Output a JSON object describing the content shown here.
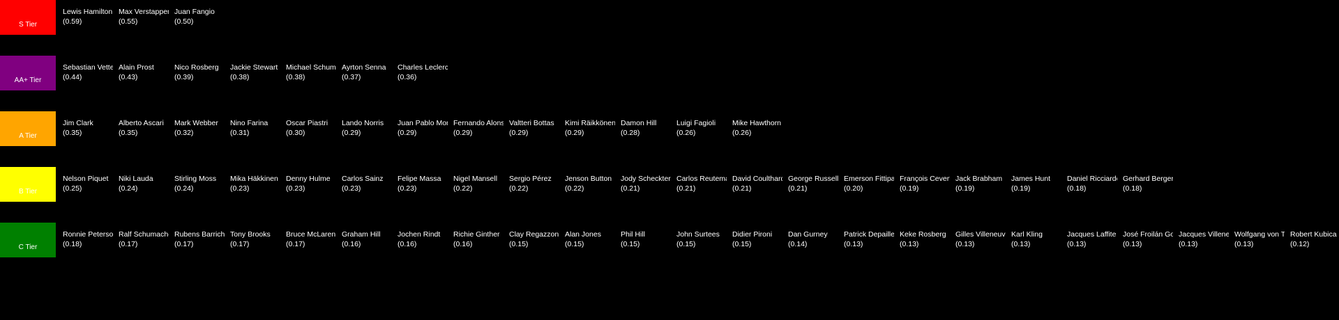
{
  "tiers": [
    {
      "key": "s",
      "label": "S Tier",
      "color": "#ff0000",
      "items": [
        {
          "name": "Lewis Hamilton",
          "score": "(0.59)"
        },
        {
          "name": "Max Verstappen",
          "score": "(0.55)"
        },
        {
          "name": "Juan Fangio",
          "score": "(0.50)"
        }
      ]
    },
    {
      "key": "aa-plus",
      "label": "AA+ Tier",
      "color": "#800080",
      "items": [
        {
          "name": "Sebastian Vettel",
          "score": "(0.44)"
        },
        {
          "name": "Alain Prost",
          "score": "(0.43)"
        },
        {
          "name": "Nico Rosberg",
          "score": "(0.39)"
        },
        {
          "name": "Jackie Stewart",
          "score": "(0.38)"
        },
        {
          "name": "Michael Schumacher",
          "score": "(0.38)"
        },
        {
          "name": "Ayrton Senna",
          "score": "(0.37)"
        },
        {
          "name": "Charles Leclerc",
          "score": "(0.36)"
        }
      ]
    },
    {
      "key": "a",
      "label": "A Tier",
      "color": "#ffa500",
      "items": [
        {
          "name": "Jim Clark",
          "score": "(0.35)"
        },
        {
          "name": "Alberto Ascari",
          "score": "(0.35)"
        },
        {
          "name": "Mark Webber",
          "score": "(0.32)"
        },
        {
          "name": "Nino Farina",
          "score": "(0.31)"
        },
        {
          "name": "Oscar Piastri",
          "score": "(0.30)"
        },
        {
          "name": "Lando Norris",
          "score": "(0.29)"
        },
        {
          "name": "Juan Pablo Montoya",
          "score": "(0.29)"
        },
        {
          "name": "Fernando Alonso",
          "score": "(0.29)"
        },
        {
          "name": "Valtteri Bottas",
          "score": "(0.29)"
        },
        {
          "name": "Kimi Räikkönen",
          "score": "(0.29)"
        },
        {
          "name": "Damon Hill",
          "score": "(0.28)"
        },
        {
          "name": "Luigi Fagioli",
          "score": "(0.26)"
        },
        {
          "name": "Mike Hawthorn",
          "score": "(0.26)"
        }
      ]
    },
    {
      "key": "b",
      "label": "B Tier",
      "color": "#ffff00",
      "items": [
        {
          "name": "Nelson Piquet",
          "score": "(0.25)"
        },
        {
          "name": "Niki Lauda",
          "score": "(0.24)"
        },
        {
          "name": "Stirling Moss",
          "score": "(0.24)"
        },
        {
          "name": "Mika Häkkinen",
          "score": "(0.23)"
        },
        {
          "name": "Denny Hulme",
          "score": "(0.23)"
        },
        {
          "name": "Carlos Sainz",
          "score": "(0.23)"
        },
        {
          "name": "Felipe Massa",
          "score": "(0.23)"
        },
        {
          "name": "Nigel Mansell",
          "score": "(0.22)"
        },
        {
          "name": "Sergio Pérez",
          "score": "(0.22)"
        },
        {
          "name": "Jenson Button",
          "score": "(0.22)"
        },
        {
          "name": "Jody Scheckter",
          "score": "(0.21)"
        },
        {
          "name": "Carlos Reutemann",
          "score": "(0.21)"
        },
        {
          "name": "David Coulthard",
          "score": "(0.21)"
        },
        {
          "name": "George Russell",
          "score": "(0.21)"
        },
        {
          "name": "Emerson Fittipaldi",
          "score": "(0.20)"
        },
        {
          "name": "François Cevert",
          "score": "(0.19)"
        },
        {
          "name": "Jack Brabham",
          "score": "(0.19)"
        },
        {
          "name": "James Hunt",
          "score": "(0.19)"
        },
        {
          "name": "Daniel Ricciardo",
          "score": "(0.18)"
        },
        {
          "name": "Gerhard Berger",
          "score": "(0.18)"
        }
      ]
    },
    {
      "key": "c",
      "label": "C Tier",
      "color": "#008000",
      "items": [
        {
          "name": "Ronnie Peterson",
          "score": "(0.18)"
        },
        {
          "name": "Ralf Schumacher",
          "score": "(0.17)"
        },
        {
          "name": "Rubens Barrichello",
          "score": "(0.17)"
        },
        {
          "name": "Tony Brooks",
          "score": "(0.17)"
        },
        {
          "name": "Bruce McLaren",
          "score": "(0.17)"
        },
        {
          "name": "Graham Hill",
          "score": "(0.16)"
        },
        {
          "name": "Jochen Rindt",
          "score": "(0.16)"
        },
        {
          "name": "Richie Ginther",
          "score": "(0.16)"
        },
        {
          "name": "Clay Regazzoni",
          "score": "(0.15)"
        },
        {
          "name": "Alan Jones",
          "score": "(0.15)"
        },
        {
          "name": "Phil Hill",
          "score": "(0.15)"
        },
        {
          "name": "John Surtees",
          "score": "(0.15)"
        },
        {
          "name": "Didier Pironi",
          "score": "(0.15)"
        },
        {
          "name": "Dan Gurney",
          "score": "(0.14)"
        },
        {
          "name": "Patrick Depailler",
          "score": "(0.13)"
        },
        {
          "name": "Keke Rosberg",
          "score": "(0.13)"
        },
        {
          "name": "Gilles Villeneuve",
          "score": "(0.13)"
        },
        {
          "name": "Karl Kling",
          "score": "(0.13)"
        },
        {
          "name": "Jacques Laffite",
          "score": "(0.13)"
        },
        {
          "name": "José Froilán González",
          "score": "(0.13)"
        },
        {
          "name": "Jacques Villeneuve",
          "score": "(0.13)"
        },
        {
          "name": "Wolfgang von Trips",
          "score": "(0.13)"
        },
        {
          "name": "Robert Kubica",
          "score": "(0.12)"
        }
      ]
    }
  ]
}
